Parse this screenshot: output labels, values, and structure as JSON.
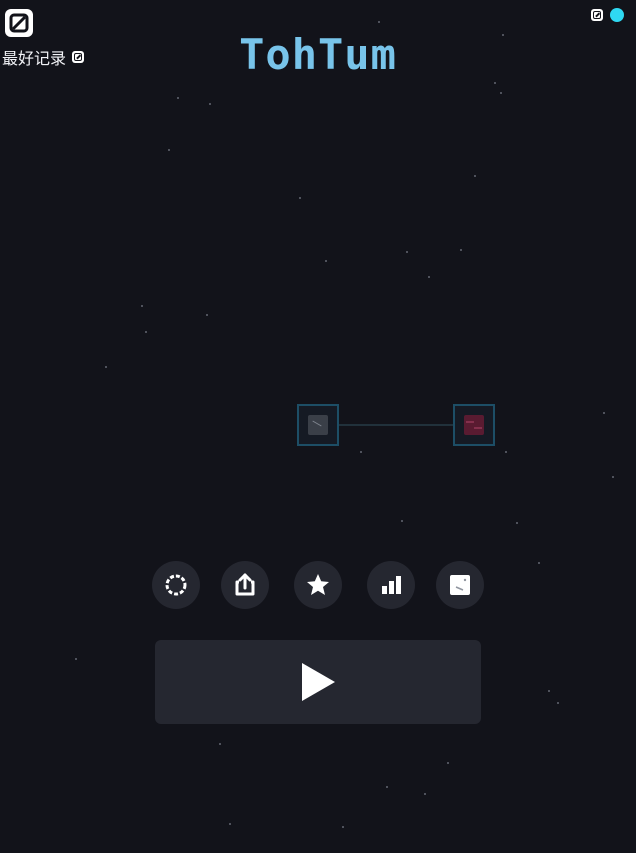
{
  "header": {
    "title": "TohTum",
    "best_record_label": "最好记录"
  },
  "colors": {
    "background": "#12131a",
    "title": "#78c4ea",
    "button_bg": "#252730",
    "icon": "#ffffff",
    "status_dot": "#2fd8f2",
    "cell_border": "#1d4e66",
    "left_tile": "#3a3f48",
    "right_tile": "#591b31"
  },
  "icons": {
    "logo": "logo-mark-icon",
    "best_record_badge": "record-badge-icon",
    "top_right_mark": "small-mark-icon",
    "status": "status-dot-icon",
    "buttons": [
      "settings-ring-icon",
      "share-icon",
      "star-icon",
      "bars-icon",
      "tile-icon"
    ],
    "play": "play-icon"
  }
}
